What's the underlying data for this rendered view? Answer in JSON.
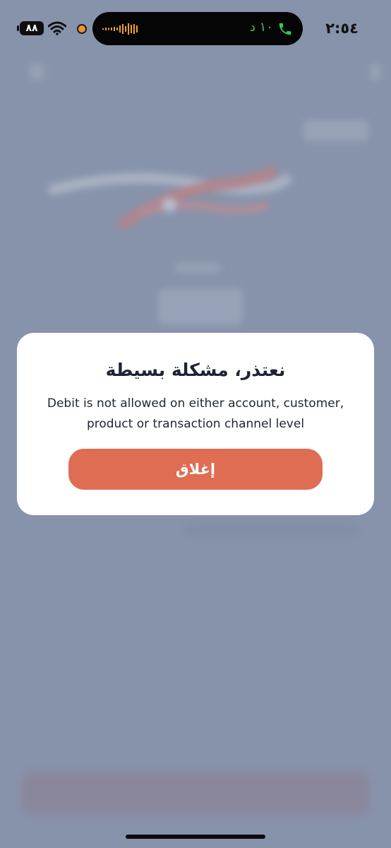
{
  "status_bar": {
    "time": "٢:٥٤",
    "battery": "٨٨",
    "call_timer": "١٠ د",
    "icons": [
      "battery-icon",
      "wifi-icon",
      "microphone-indicator-icon",
      "audio-waveform-icon",
      "phone-icon"
    ],
    "colors": {
      "call_green": "#34c759",
      "mic_orange": "#f0932b"
    }
  },
  "dialog": {
    "title": "نعتذر، مشكلة بسيطة",
    "message": "Debit is not allowed on either account, customer, product or transaction channel level",
    "close_label": "إغلاق"
  },
  "colors": {
    "overlay": "#8793ab",
    "primary_button": "#de6d53",
    "dialog_background": "#ffffff",
    "title_text": "#1d2433"
  }
}
